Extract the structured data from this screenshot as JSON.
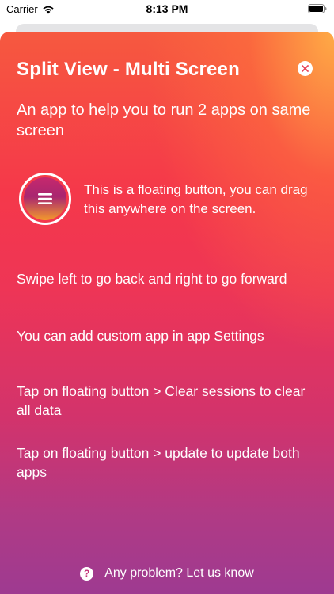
{
  "status_bar": {
    "carrier": "Carrier",
    "time": "8:13 PM"
  },
  "sheet": {
    "title": "Split View - Multi Screen",
    "subtitle": "An app to help you to run 2 apps on same screen",
    "floating_button_description": "This is a floating button, you can drag this anywhere on the screen.",
    "tips": [
      "Swipe left to go back and right to go forward",
      "You can add custom app in app Settings",
      "Tap on floating button > Clear sessions to clear all data",
      "Tap on floating button > update to update both apps"
    ],
    "help_link": "Any problem? Let us know"
  },
  "icons": {
    "wifi": "wifi-icon",
    "battery": "battery-icon",
    "close": "close-icon",
    "floating_menu": "menu-lines-icon",
    "help": "question-mark-icon"
  },
  "colors": {
    "gradient_top": "#f6593f",
    "gradient_mid": "#ee3556",
    "gradient_bottom": "#9c3a92",
    "accent_orange": "#ffaf46",
    "text": "#ffffff"
  }
}
